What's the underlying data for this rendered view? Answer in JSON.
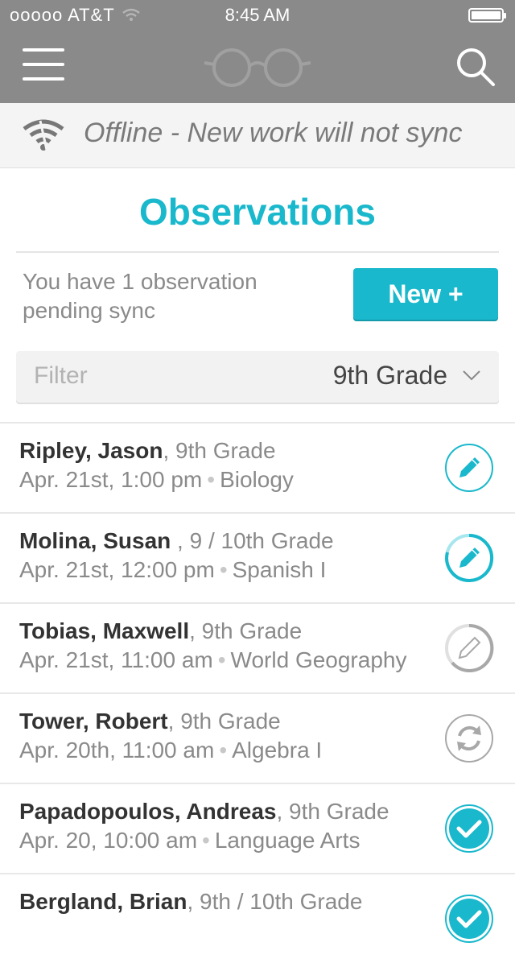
{
  "status_bar": {
    "carrier": "ooooo AT&T",
    "time": "8:45 AM"
  },
  "offline_banner": {
    "text": "Offline - New work will not sync"
  },
  "page_title": "Observations",
  "pending": {
    "text": "You have 1 observation pending sync"
  },
  "new_button": {
    "label": "New +"
  },
  "filter": {
    "label": "Filter",
    "value": "9th Grade"
  },
  "observations": [
    {
      "name": "Ripley, Jason",
      "grade": "9th Grade",
      "date": "Apr. 21st, 1:00 pm",
      "subject": "Biology",
      "status_icon": "edit-icon-active"
    },
    {
      "name": "Molina, Susan",
      "grade": "9 / 10th Grade",
      "date": "Apr. 21st, 12:00 pm",
      "subject": "Spanish I",
      "status_icon": "edit-icon-progress"
    },
    {
      "name": "Tobias, Maxwell",
      "grade": "9th Grade",
      "date": "Apr. 21st, 11:00 am",
      "subject": "World Geography",
      "status_icon": "edit-icon-inactive"
    },
    {
      "name": "Tower, Robert",
      "grade": "9th Grade",
      "date": "Apr. 20th, 11:00 am",
      "subject": "Algebra I",
      "status_icon": "sync-icon"
    },
    {
      "name": "Papadopoulos, Andreas",
      "grade": "9th Grade",
      "date": "Apr. 20, 10:00 am",
      "subject": "Language Arts",
      "status_icon": "check-icon"
    },
    {
      "name": "Bergland, Brian",
      "grade": "9th / 10th Grade",
      "date": "",
      "subject": "",
      "status_icon": "check-icon"
    }
  ],
  "colors": {
    "accent": "#1ab8cc",
    "navbar": "#8a8a8a",
    "inactive": "#a8a8a8"
  }
}
